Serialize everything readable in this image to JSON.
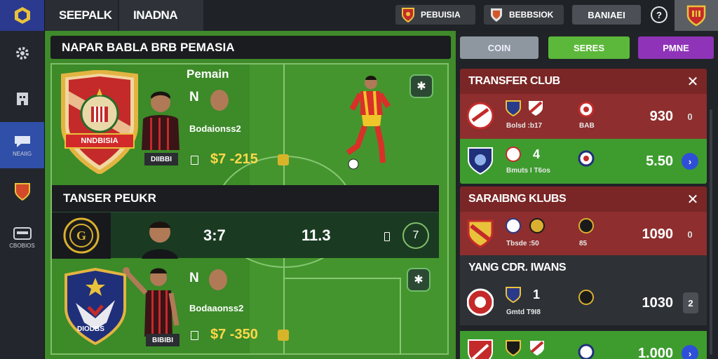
{
  "topbar": {
    "tab_primary": "SEEPALK",
    "tab_secondary": "INADNA",
    "btn_one": "PEBUISIA",
    "btn_two": "BEBBSIOK",
    "btn_three": "BANIAEI",
    "help_glyph": "?"
  },
  "sidebar": {
    "items": [
      {
        "icon": "gear-icon",
        "label": ""
      },
      {
        "icon": "building-icon",
        "label": ""
      },
      {
        "icon": "chat-bubble-icon",
        "label": "NEAIIG"
      },
      {
        "icon": "shield-icon",
        "label": ""
      },
      {
        "icon": "card-icon",
        "label": "CBOBIOS"
      }
    ]
  },
  "main": {
    "title": "NAPAR BABLA BRB PEMASIA",
    "card_top": {
      "crest_banner": "NNDBISIA",
      "heading": "Pemain",
      "tag_n": "N",
      "name": "Bodaionss2",
      "photo_tag": "DIIBBI",
      "price": "$7 -215"
    },
    "section_label": "TANSER PEUKR",
    "strip": {
      "score_a": "3:7",
      "score_b": "11.3",
      "circle_num": "7"
    },
    "card_bottom": {
      "crest_banner": "DIODBS",
      "tag_n": "N",
      "name": "Bodaaonss2",
      "photo_tag": "BIBIBI",
      "price": "$7 -350"
    }
  },
  "right": {
    "btn_coin": "COIN",
    "btn_series": "SERES",
    "btn_prime": "PMNE",
    "panels": [
      {
        "title": "TRANSFER CLUB",
        "rows": [
          {
            "sub": "Bolsd :b17",
            "sub2": "BAB",
            "value": "930",
            "action": "0"
          },
          {
            "big": "4",
            "sub": "Bmuts I T6os",
            "value": "5.50",
            "action": "›"
          }
        ]
      },
      {
        "title": "SARAIBNG KLUBS",
        "rows": [
          {
            "sub": "Tbsde :50",
            "sub2": "85",
            "value": "1090",
            "action": "0"
          }
        ]
      },
      {
        "title": "YANG CDR. IWANS",
        "rows": [
          {
            "big": "1",
            "sub": "Gmtd T9I8",
            "value": "1030",
            "action": "2"
          },
          {
            "sub": "",
            "value": "1.000",
            "action": "›"
          }
        ]
      }
    ]
  },
  "colors": {
    "accent_green": "#5cb83a",
    "accent_purple": "#8f34b8",
    "panel_red": "#8e2e2e"
  }
}
